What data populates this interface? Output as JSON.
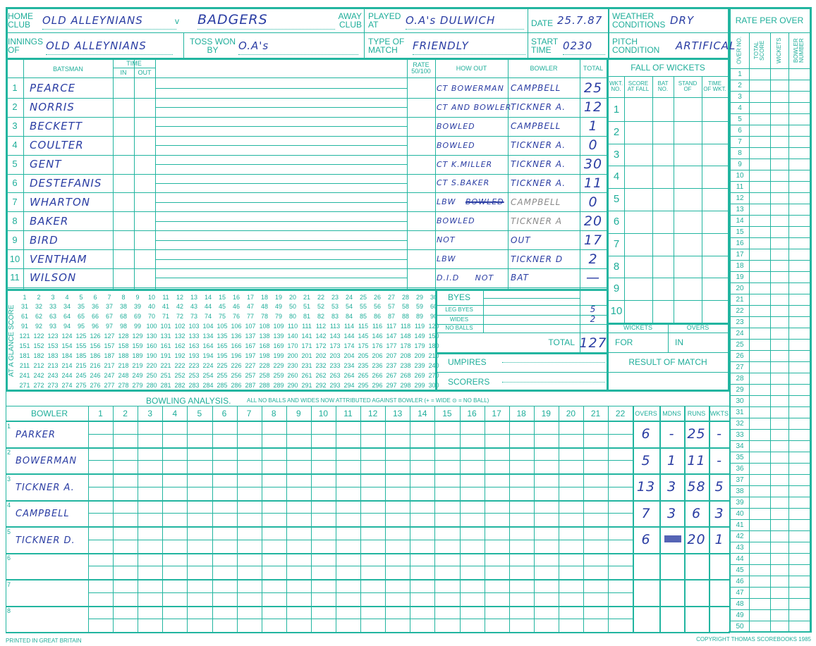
{
  "colors": {
    "form": "#22b5a0",
    "ink": "#2a3da3"
  },
  "header": {
    "home_club_label": "HOME\nCLUB",
    "home_club": "OLD ALLEYNIANS",
    "versus": "v",
    "away_club": "BADGERS",
    "away_club_label": "AWAY\nCLUB",
    "played_at_label": "PLAYED\nAT",
    "played_at": "O.A's DULWICH",
    "date_label": "DATE",
    "date": "25.7.87",
    "weather_label": "WEATHER\nCONDITIONS",
    "weather": "DRY",
    "innings_label": "INNINGS\nOF",
    "innings_of": "OLD ALLEYNIANS",
    "toss_label": "TOSS WON\nBY",
    "toss_won_by": "O.A's",
    "match_type_label": "TYPE OF\nMATCH",
    "match_type": "FRIENDLY",
    "start_time_label": "START\nTIME",
    "start_time": "0230",
    "pitch_label": "PITCH\nCONDITION",
    "pitch": "ARTIFICAL"
  },
  "batting": {
    "headers": {
      "batsman": "BATSMAN",
      "time": "TIME",
      "in": "IN",
      "out": "OUT",
      "rate": "RATE\n50/100",
      "how_out": "HOW OUT",
      "bowler": "BOWLER",
      "total": "TOTAL"
    },
    "rows": [
      {
        "no": "1",
        "name": "PEARCE",
        "how_out": "CT BOWERMAN",
        "bowler": "CAMPBELL",
        "total": "25"
      },
      {
        "no": "2",
        "name": "NORRIS",
        "how_out": "CT AND BOWLER",
        "bowler": "TICKNER A.",
        "total": "12"
      },
      {
        "no": "3",
        "name": "BECKETT",
        "how_out": "BOWLED",
        "bowler": "CAMPBELL",
        "total": "1"
      },
      {
        "no": "4",
        "name": "COULTER",
        "how_out": "BOWLED",
        "bowler": "TICKNER A.",
        "total": "0"
      },
      {
        "no": "5",
        "name": "GENT",
        "how_out": "CT K.MILLER",
        "bowler": "TICKNER A.",
        "total": "30"
      },
      {
        "no": "6",
        "name": "DESTEFANIS",
        "how_out": "CT S.BAKER",
        "bowler": "TICKNER A.",
        "total": "11"
      },
      {
        "no": "7",
        "name": "WHARTON",
        "how_out": "LBW",
        "how_out_struck": "BOWLED",
        "bowler": "CAMPBELL",
        "total": "0"
      },
      {
        "no": "8",
        "name": "BAKER",
        "how_out": "BOWLED",
        "bowler": "TICKNER A",
        "total": "20"
      },
      {
        "no": "9",
        "name": "BIRD",
        "how_out": "NOT",
        "bowler": "OUT",
        "total": "17"
      },
      {
        "no": "10",
        "name": "VENTHAM",
        "how_out": "LBW",
        "bowler": "TICKNER D",
        "total": "2"
      },
      {
        "no": "11",
        "name": "WILSON",
        "how_out": "D.I.D     NOT",
        "bowler": "BAT",
        "total": "—"
      }
    ]
  },
  "fall_of_wickets": {
    "title": "FALL OF WICKETS",
    "headers": [
      "WKT.\nNO.",
      "SCORE\nAT FALL",
      "BAT\nNO.",
      "STAND\nOF",
      "TIME\nOF WKT."
    ],
    "wickets": [
      "1",
      "2",
      "3",
      "4",
      "5",
      "6",
      "7",
      "8",
      "9",
      "10"
    ]
  },
  "at_a_glance_label": "AT A GLANCE SCORE",
  "extras": {
    "byes_label": "BYES",
    "byes": "",
    "leg_byes_label": "LEG BYES",
    "leg_byes": "5",
    "wides_label": "WIDES",
    "wides": "2",
    "no_balls_label": "NO BALLS",
    "no_balls": "",
    "total_label": "TOTAL",
    "total": "127"
  },
  "officials": {
    "umpires_label": "UMPIRES",
    "scorers_label": "SCORERS"
  },
  "summary": {
    "wickets_label": "WICKETS",
    "overs_label": "OVERS",
    "for_label": "FOR",
    "in_label": "IN",
    "result_label": "RESULT OF MATCH"
  },
  "bowling": {
    "title": "BOWLING ANALYSIS.",
    "note": "ALL NO BALLS AND WIDES NOW ATTRIBUTED AGAINST BOWLER (+  =  WIDE   ⊙  =  NO BALL)",
    "bowler_header": "BOWLER",
    "overs_header": "OVERS",
    "mdns_header": "MDNS",
    "runs_header": "RUNS",
    "wkts_header": "WKTS",
    "rows": [
      {
        "no": "1",
        "name": "PARKER",
        "overs": "6",
        "mdns": "-",
        "runs": "25",
        "wkts": "-"
      },
      {
        "no": "2",
        "name": "BOWERMAN",
        "overs": "5",
        "mdns": "1",
        "runs": "11",
        "wkts": "-"
      },
      {
        "no": "3",
        "name": "TICKNER A.",
        "overs": "13",
        "mdns": "3",
        "runs": "58",
        "wkts": "5"
      },
      {
        "no": "4",
        "name": "CAMPBELL",
        "overs": "7",
        "mdns": "3",
        "runs": "6",
        "wkts": "3"
      },
      {
        "no": "5",
        "name": "TICKNER D.",
        "overs": "6",
        "mdns": "",
        "runs": "20",
        "wkts": "1"
      },
      {
        "no": "6",
        "name": "",
        "overs": "",
        "mdns": "",
        "runs": "",
        "wkts": ""
      },
      {
        "no": "7",
        "name": "",
        "overs": "",
        "mdns": "",
        "runs": "",
        "wkts": ""
      },
      {
        "no": "8",
        "name": "",
        "overs": "",
        "mdns": "",
        "runs": "",
        "wkts": ""
      }
    ]
  },
  "rate_per_over": {
    "title": "RATE PER OVER",
    "headers": [
      "OVER NO.",
      "TOTAL\nSCORE",
      "WICKETS",
      "BOWLER\nNUMBER"
    ]
  },
  "footer": {
    "left": "PRINTED IN GREAT BRITAIN",
    "right": "COPYRIGHT THOMAS SCOREBOOKS 1985"
  }
}
